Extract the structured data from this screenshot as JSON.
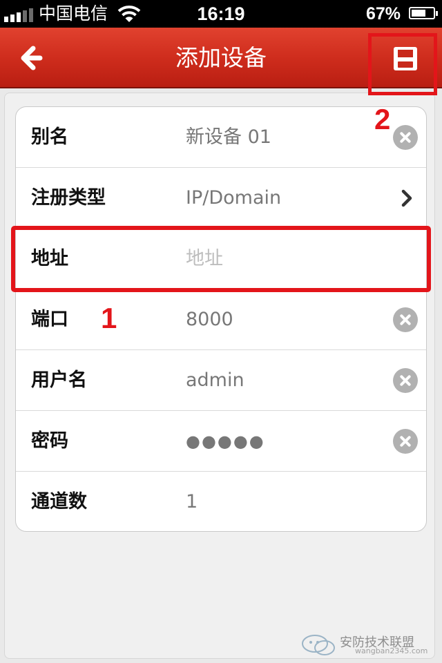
{
  "status_bar": {
    "carrier": "中国电信",
    "time": "16:19",
    "battery": "67%",
    "battery_level": 0.67,
    "signal_bars": 3
  },
  "nav": {
    "title": "添加设备",
    "back_icon": "arrow-left-icon",
    "save_icon": "floppy-disk-icon"
  },
  "form": {
    "rows": [
      {
        "label": "别名",
        "value": "新设备 01",
        "accessory": "clear"
      },
      {
        "label": "注册类型",
        "value": "IP/Domain",
        "accessory": "chevron"
      },
      {
        "label": "地址",
        "placeholder": "地址",
        "accessory": "none"
      },
      {
        "label": "端口",
        "value": "8000",
        "accessory": "clear"
      },
      {
        "label": "用户名",
        "value": "admin",
        "accessory": "clear"
      },
      {
        "label": "密码",
        "value": "●●●●●",
        "accessory": "clear"
      },
      {
        "label": "通道数",
        "value": "1",
        "accessory": "none"
      }
    ]
  },
  "annotations": {
    "marker_1": "1",
    "marker_2": "2",
    "highlight_color": "#e3151a"
  },
  "watermark": {
    "text": "安防技术联盟",
    "subtext": "wangban2345.com"
  },
  "colors": {
    "nav_red": "#cf2d1d",
    "clear_gray": "#b1b1b1"
  }
}
